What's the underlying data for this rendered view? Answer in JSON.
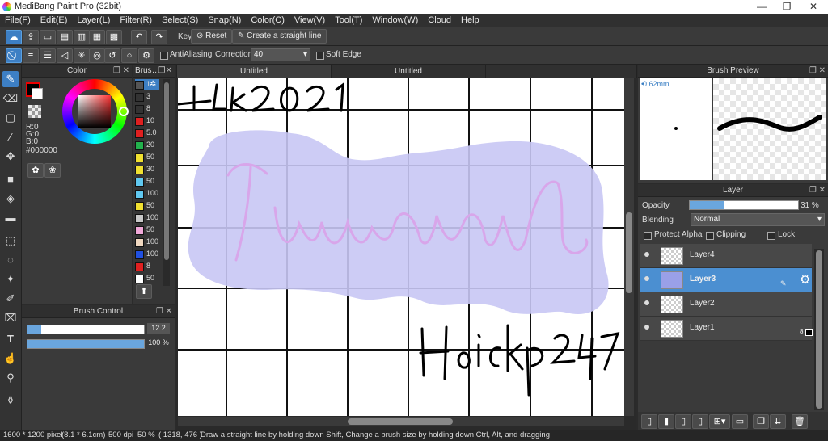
{
  "window": {
    "title": "MediBang Paint Pro (32bit)",
    "minimize": "—",
    "maximize": "❐",
    "close": "✕"
  },
  "menu": [
    "File(F)",
    "Edit(E)",
    "Layer(L)",
    "Filter(R)",
    "Select(S)",
    "Snap(N)",
    "Color(C)",
    "View(V)",
    "Tool(T)",
    "Window(W)",
    "Cloud",
    "Help"
  ],
  "toolbar": {
    "key_label": "Key",
    "reset_label": "Reset",
    "straight_line_label": "Create a straight line"
  },
  "toolbar2": {
    "antialiasing_label": "AntiAliasing",
    "correction_label": "Correction",
    "correction_value": "40",
    "soft_edge_label": "Soft Edge"
  },
  "color_panel": {
    "title": "Color",
    "r": "R:0",
    "g": "G:0",
    "b": "B:0",
    "hex": "#000000",
    "fg_color": "#000000"
  },
  "brush_panel": {
    "title": "Brus",
    "sizes": [
      {
        "n": "1",
        "c": "#555555"
      },
      {
        "n": "3",
        "c": "#333333"
      },
      {
        "n": "8",
        "c": "#333333"
      },
      {
        "n": "10",
        "c": "#e02020"
      },
      {
        "n": "5.0",
        "c": "#e02020"
      },
      {
        "n": "20",
        "c": "#22b14c"
      },
      {
        "n": "50",
        "c": "#f0e030"
      },
      {
        "n": "30",
        "c": "#f0e030"
      },
      {
        "n": "50",
        "c": "#60c8f0"
      },
      {
        "n": "100",
        "c": "#60c8f0"
      },
      {
        "n": "50",
        "c": "#f0e030"
      },
      {
        "n": "100",
        "c": "#c8c8c8"
      },
      {
        "n": "50",
        "c": "#f0a8d8"
      },
      {
        "n": "100",
        "c": "#f0d8c0"
      },
      {
        "n": "100",
        "c": "#2050e0"
      },
      {
        "n": "8",
        "c": "#e02020"
      },
      {
        "n": "50",
        "c": "#ffffff"
      }
    ]
  },
  "brush_control": {
    "title": "Brush Control",
    "size_value": "12.2",
    "opacity_value": "100 %",
    "size_fraction": 0.12,
    "opacity_fraction": 1.0
  },
  "tabs": [
    "Untitled",
    "Untitled"
  ],
  "canvas_text": {
    "top_left": "tlk2021",
    "bottom_right": "Hoickp247"
  },
  "brush_preview": {
    "title": "Brush Preview",
    "size_text": "0.62mm"
  },
  "layer_panel": {
    "title": "Layer",
    "opacity_label": "Opacity",
    "opacity_value": "31 %",
    "opacity_fraction": 0.31,
    "blending_label": "Blending",
    "blending_value": "Normal",
    "protect_alpha_label": "Protect Alpha",
    "clipping_label": "Clipping",
    "lock_label": "Lock",
    "layers": [
      {
        "name": "Layer4",
        "selected": false
      },
      {
        "name": "Layer3",
        "selected": true
      },
      {
        "name": "Layer2",
        "selected": false
      },
      {
        "name": "Layer1",
        "selected": false
      }
    ],
    "layer1_badge": "8"
  },
  "status": {
    "size": "1600 * 1200 pixel",
    "cm": "(8.1 * 6.1cm)",
    "dpi": "500 dpi",
    "zoom": "50 %",
    "coords": "( 1318, 476 )",
    "hint": "Draw a straight line by holding down Shift, Change a brush size by holding down Ctrl, Alt, and dragging"
  }
}
